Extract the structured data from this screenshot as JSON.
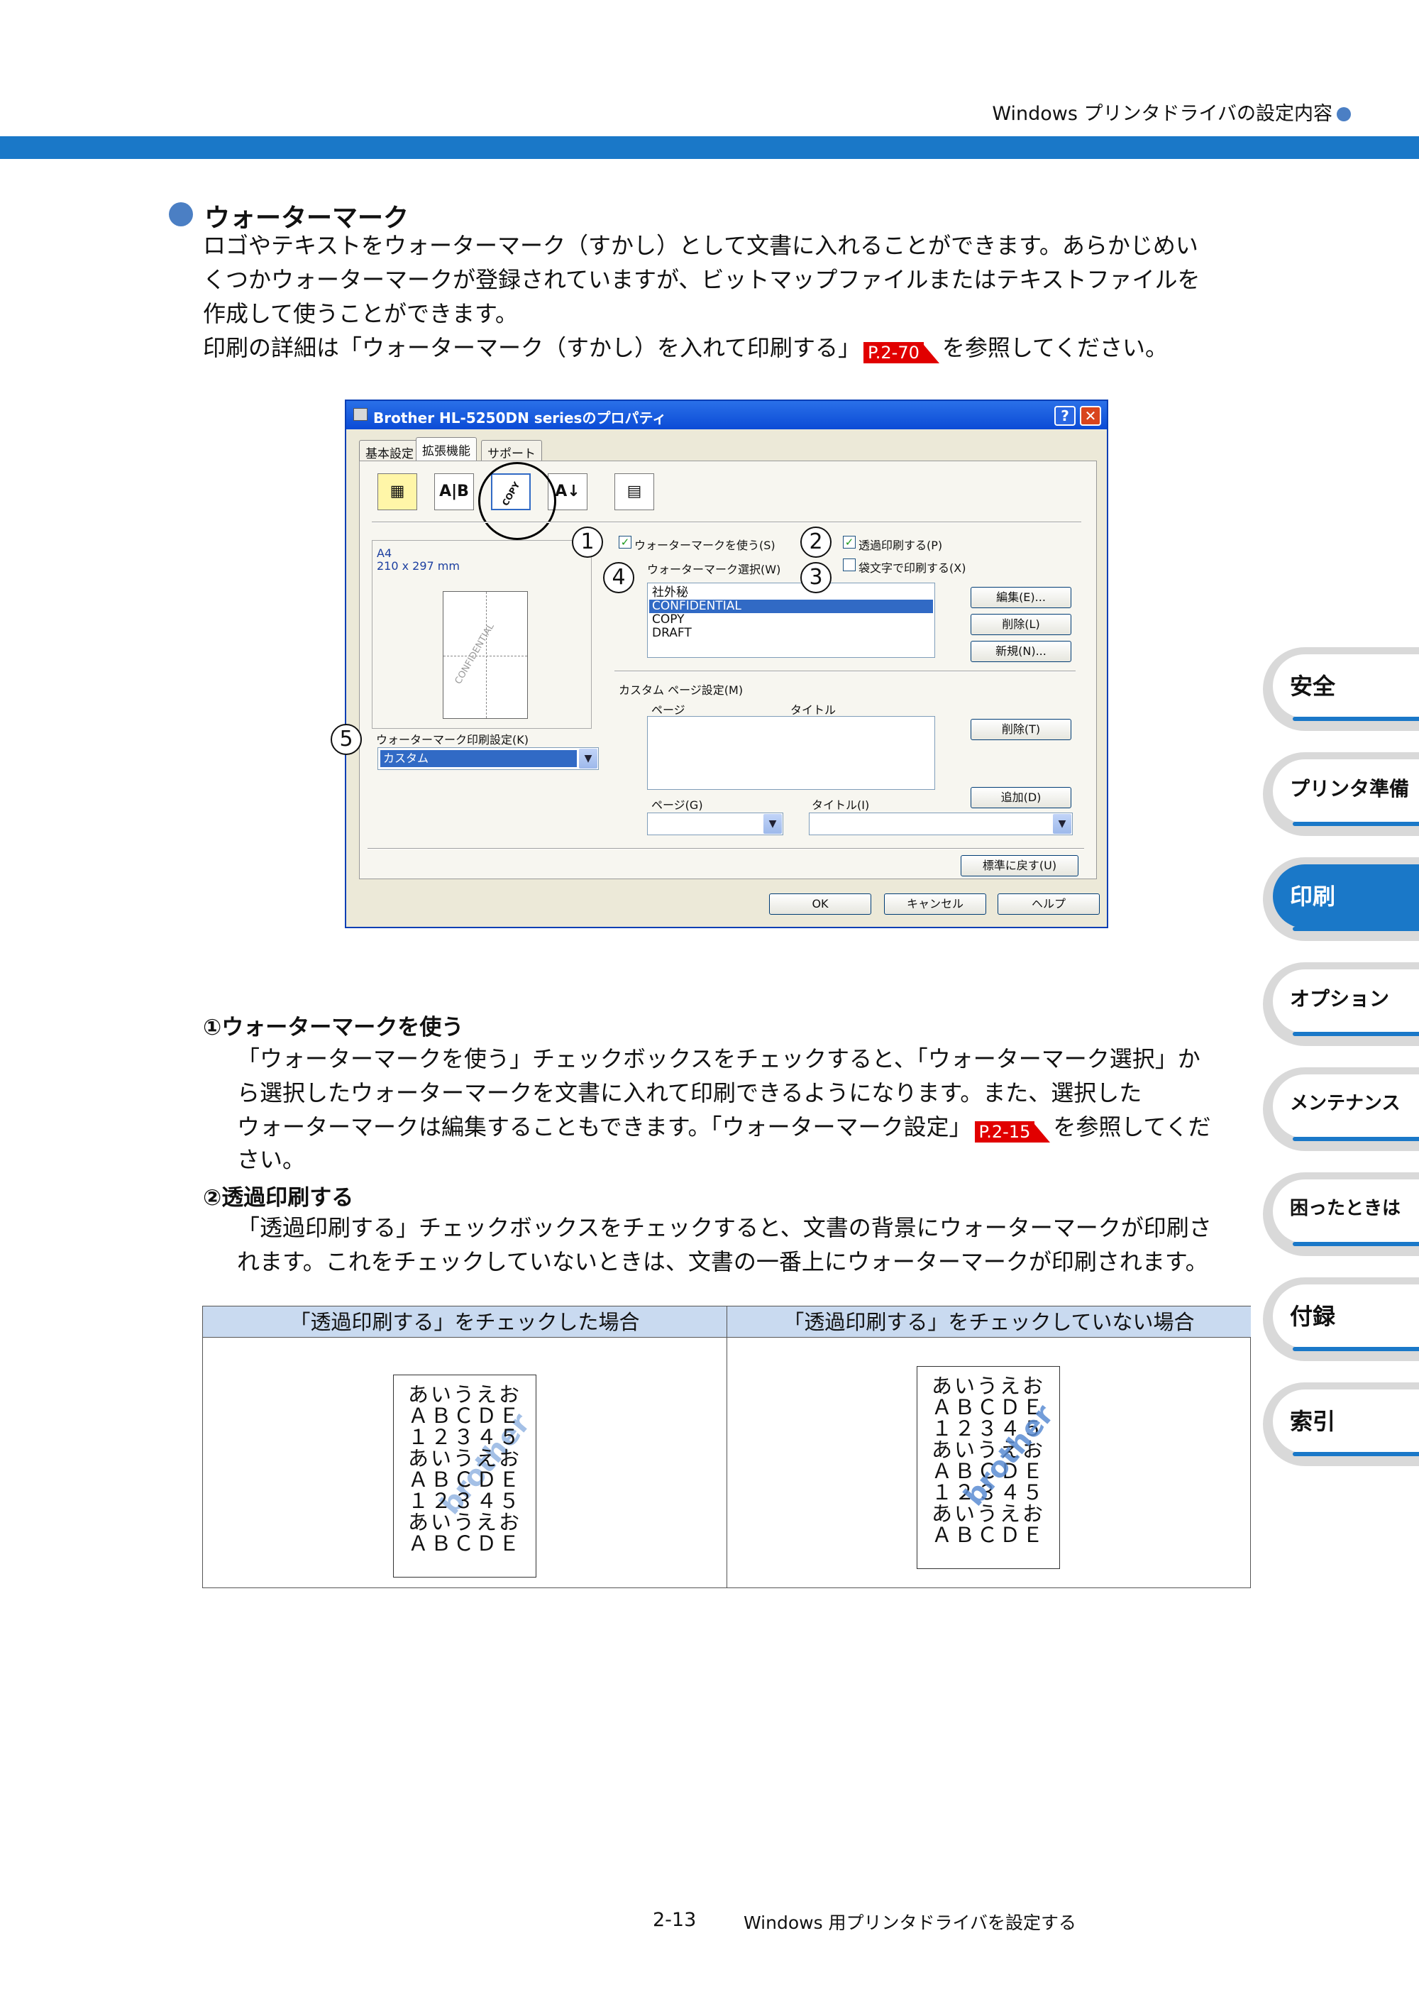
{
  "header": {
    "title": "Windows プリンタドライバの設定内容"
  },
  "section": {
    "title": "ウォーターマーク",
    "lines": [
      "ロゴやテキストをウォーターマーク（すかし）として文書に入れることができます。あらかじめい",
      "くつかウォーターマークが登録されていますが、ビットマップファイルまたはテキストファイルを",
      "作成して使うことができます。"
    ],
    "ref_line_pre": "印刷の詳細は「ウォーターマーク（すかし）を入れて印刷する」",
    "ref_tag": "P.2-70",
    "ref_line_post": "を参照してください。"
  },
  "dialog": {
    "title": "Brother HL-5250DN seriesのプロパティ",
    "help_btn": "?",
    "close_btn": "✕",
    "tabs": [
      "基本設定",
      "拡張機能",
      "サポート"
    ],
    "paper_size": "A4",
    "paper_dims": "210 x 297 mm",
    "use_watermark": "ウォーターマークを使う(S)",
    "transparent": "透過印刷する(P)",
    "outline": "袋文字で印刷する(X)",
    "select_label": "ウォーターマーク選択(W)",
    "list": [
      "社外秘",
      "CONFIDENTIAL",
      "COPY",
      "DRAFT"
    ],
    "edit_btn": "編集(E)...",
    "delete_btn": "削除(L)",
    "new_btn": "新規(N)...",
    "custom_label": "カスタム ページ設定(M)",
    "col_page": "ページ",
    "col_title": "タイトル",
    "delete2_btn": "削除(T)",
    "add_btn": "追加(D)",
    "page_combo_label": "ページ(G)",
    "title_combo_label": "タイトル(I)",
    "print_setting_label": "ウォーターマーク印刷設定(K)",
    "print_setting_value": "カスタム",
    "reset_btn": "標準に戻す(U)",
    "ok_btn": "OK",
    "cancel_btn": "キャンセル",
    "help2_btn": "ヘルプ",
    "preview_watermark": "CONFIDENTIAL",
    "icon_copy": "COPY"
  },
  "callouts": [
    "1",
    "2",
    "3",
    "4",
    "5"
  ],
  "item1": {
    "title": "①ウォーターマークを使う",
    "lines": [
      "「ウォーターマークを使う」チェックボックスをチェックすると、「ウォーターマーク選択」か",
      "ら選択したウォーターマークを文書に入れて印刷できるようになります。また、選択した"
    ],
    "line3_pre": "ウォーターマークは編集することもできます。「ウォーターマーク設定」",
    "ref_tag": "P.2-15",
    "line3_post": "を参照してくだ",
    "line4": "さい。"
  },
  "item2": {
    "title": "②透過印刷する",
    "lines": [
      "「透過印刷する」チェックボックスをチェックすると、文書の背景にウォーターマークが印刷さ",
      "れます。これをチェックしていないときは、文書の一番上にウォーターマークが印刷されます。"
    ]
  },
  "compare": {
    "left_header": "「透過印刷する」をチェックした場合",
    "right_header": "「透過印刷する」をチェックしていない場合",
    "sample_lines": [
      "あいうえお",
      "ＡＢＣＤＥ",
      "１２３４５",
      "あいうえお",
      "ＡＢＣＤＥ",
      "１２３４５",
      "あいうえお",
      "ＡＢＣＤＥ"
    ],
    "watermark": "brother"
  },
  "side_tabs": [
    "安全",
    "プリンタ準備",
    "印刷",
    "オプション",
    "メンテナンス",
    "困ったときは",
    "付録",
    "索引"
  ],
  "side_active": "印刷",
  "footer": {
    "page": "2-13",
    "title": "Windows 用プリンタドライバを設定する"
  },
  "colors": {
    "accent": "#1a78c8",
    "ref": "#e10000",
    "table_header": "#c9daf0"
  }
}
